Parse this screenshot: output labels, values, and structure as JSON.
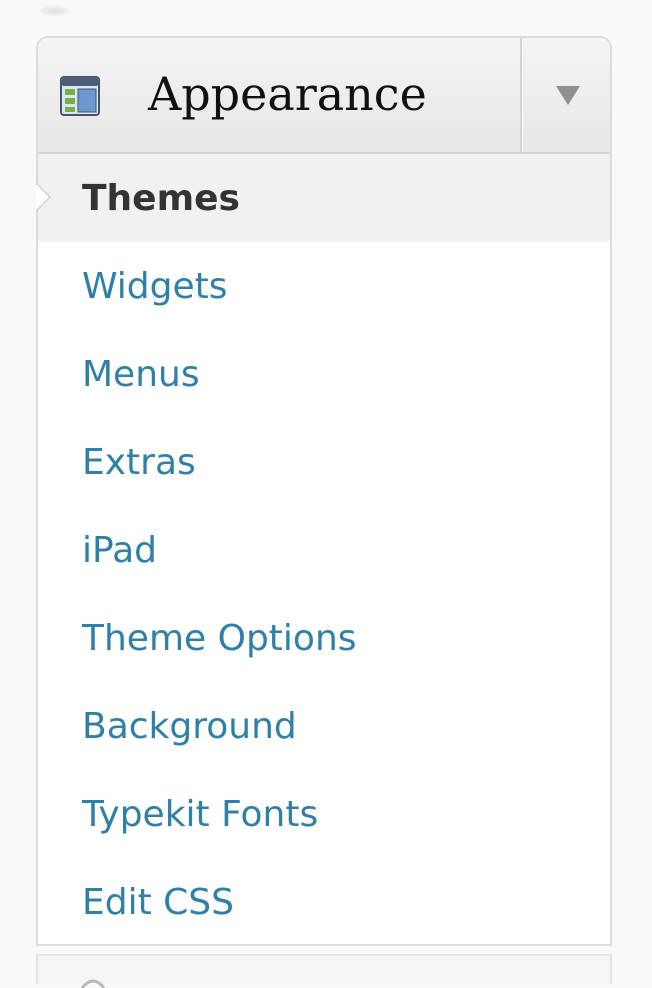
{
  "menu": {
    "title": "Appearance",
    "icon": "appearance-icon",
    "toggle_icon": "triangle-down-icon",
    "items": [
      {
        "label": "Themes",
        "current": true
      },
      {
        "label": "Widgets",
        "current": false
      },
      {
        "label": "Menus",
        "current": false
      },
      {
        "label": "Extras",
        "current": false
      },
      {
        "label": "iPad",
        "current": false
      },
      {
        "label": "Theme Options",
        "current": false
      },
      {
        "label": "Background",
        "current": false
      },
      {
        "label": "Typekit Fonts",
        "current": false
      },
      {
        "label": "Edit CSS",
        "current": false
      }
    ]
  },
  "colors": {
    "link": "#2e80a8",
    "current_text": "#333333",
    "current_bg": "#f1f1f1",
    "header_bg": "#ececec",
    "border": "#dcdcdc"
  }
}
